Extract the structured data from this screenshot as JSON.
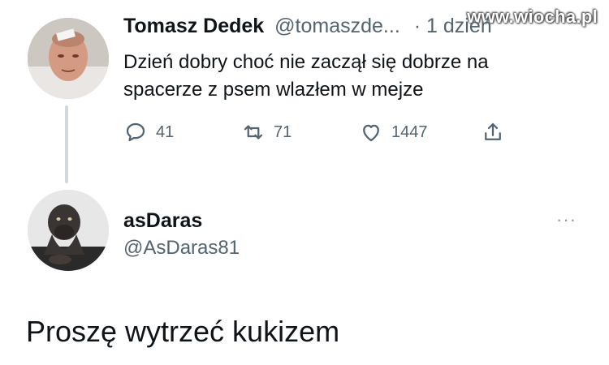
{
  "watermark": "www.wiocha.pl",
  "tweet": {
    "author_name": "Tomasz Dedek",
    "author_handle": "@tomaszde...",
    "time": "· 1 dzień",
    "text": "Dzień dobry  choć nie zaczął się dobrze na spacerze z psem wlazłem w mejze",
    "stats": {
      "replies": "41",
      "retweets": "71",
      "likes": "1447"
    }
  },
  "reply": {
    "author_name": "asDaras",
    "author_handle": "@AsDaras81",
    "more": "···",
    "text": "Proszę wytrzeć kukizem"
  },
  "icons": {
    "reply": "reply-icon",
    "retweet": "retweet-icon",
    "like": "heart-icon",
    "share": "share-icon"
  },
  "colors": {
    "text": "#0f1419",
    "secondary": "#536471",
    "thread_line": "#cfd9de"
  }
}
